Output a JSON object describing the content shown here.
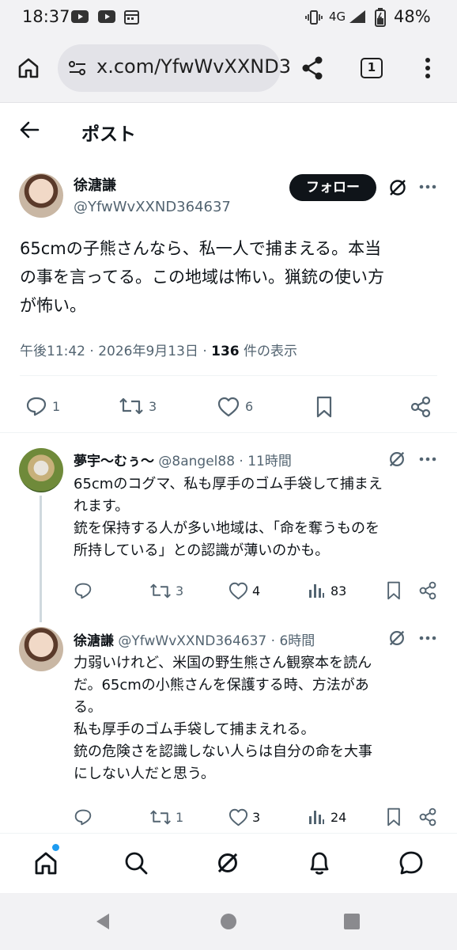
{
  "status_bar": {
    "time": "18:37",
    "network": "4G",
    "battery": "48%",
    "icons": [
      "youtube-icon",
      "youtube-icon",
      "calendar-icon",
      "vibrate-icon",
      "signal-icon",
      "battery-icon"
    ]
  },
  "browser": {
    "url": "x.com/YfwWvXXND3",
    "tab_count": "1",
    "icons": [
      "home-icon",
      "site-settings-icon",
      "share-icon",
      "tabs-icon",
      "more-vertical-icon"
    ]
  },
  "header": {
    "title": "ポスト"
  },
  "main_post": {
    "name": "徐溏謙",
    "handle": "@YfwWvXXND364637",
    "follow_label": "フォロー",
    "text": "65cmの子熊さんなら、私一人で捕まえる。本当\nの事を言ってる。この地域は怖い。猟銃の使い方\nが怖い。",
    "time": "午後11:42 · 2026年9月13日 · ",
    "views_count": "136",
    "views_label": " 件の表示",
    "actions": {
      "replies": "1",
      "reposts": "3",
      "likes": "6"
    }
  },
  "replies": [
    {
      "name": "夢宇〜むぅ〜",
      "handle": "@8angel88 · 11時間",
      "text": "65cmのコグマ、私も厚手のゴム手袋して捕まえ\nれます。\n銃を保持する人が多い地域は、「命を奪うものを\n所持している」との認識が薄いのかも。",
      "replies": "",
      "reposts": "3",
      "likes": "4",
      "views": "83"
    },
    {
      "name": "徐溏謙",
      "handle": "@YfwWvXXND364637 · 6時間",
      "text": "力弱いけれど、米国の野生熊さん観察本を読ん\nだ。65cmの小熊さんを保護する時、方法があ\nる。\n私も厚手のゴム手袋して捕まえれる。\n銃の危険さを認識しない人らは自分の命を大事\nにしない人だと思う。",
      "replies": "",
      "reposts": "1",
      "likes": "3",
      "views": "24"
    }
  ],
  "bottom_nav": {
    "items": [
      "home-icon",
      "search-icon",
      "grok-icon",
      "notifications-icon",
      "messages-icon"
    ]
  },
  "colors": {
    "accent": "#1d9bf0",
    "text": "#0f1419",
    "secondary": "#536471",
    "chrome_bg": "#f2f2f4"
  }
}
